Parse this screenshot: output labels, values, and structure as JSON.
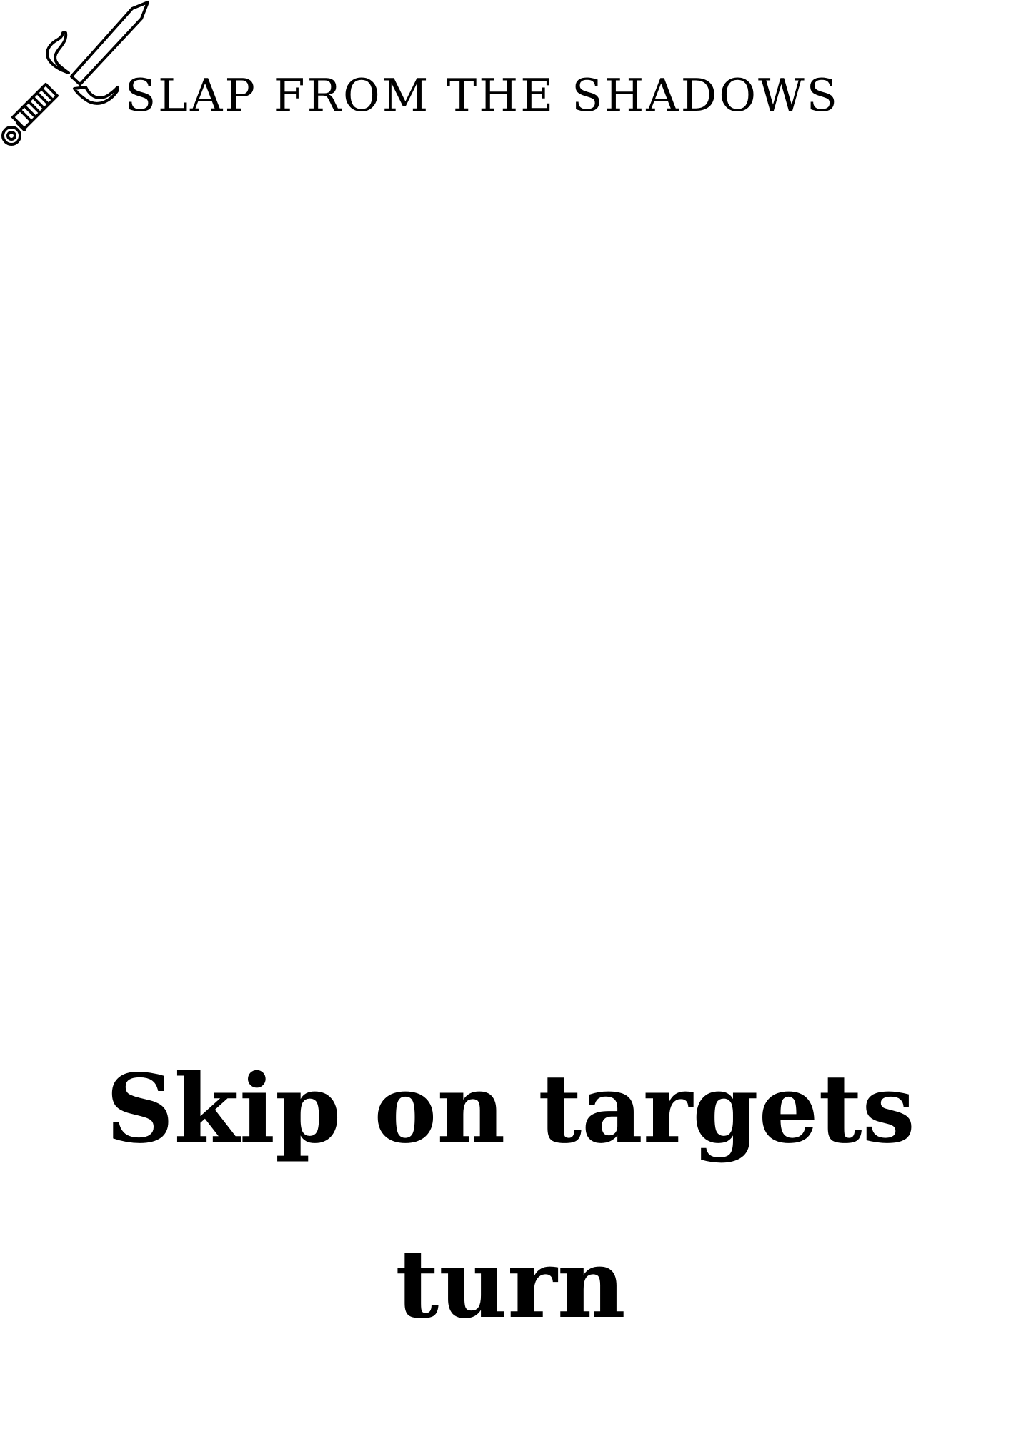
{
  "card": {
    "title": "SLAP FROM THE SHADOWS",
    "effect_text": "Skip on targets turn",
    "icon": "sword-icon"
  },
  "colors": {
    "background": "#ffffff",
    "ink": "#000000"
  }
}
